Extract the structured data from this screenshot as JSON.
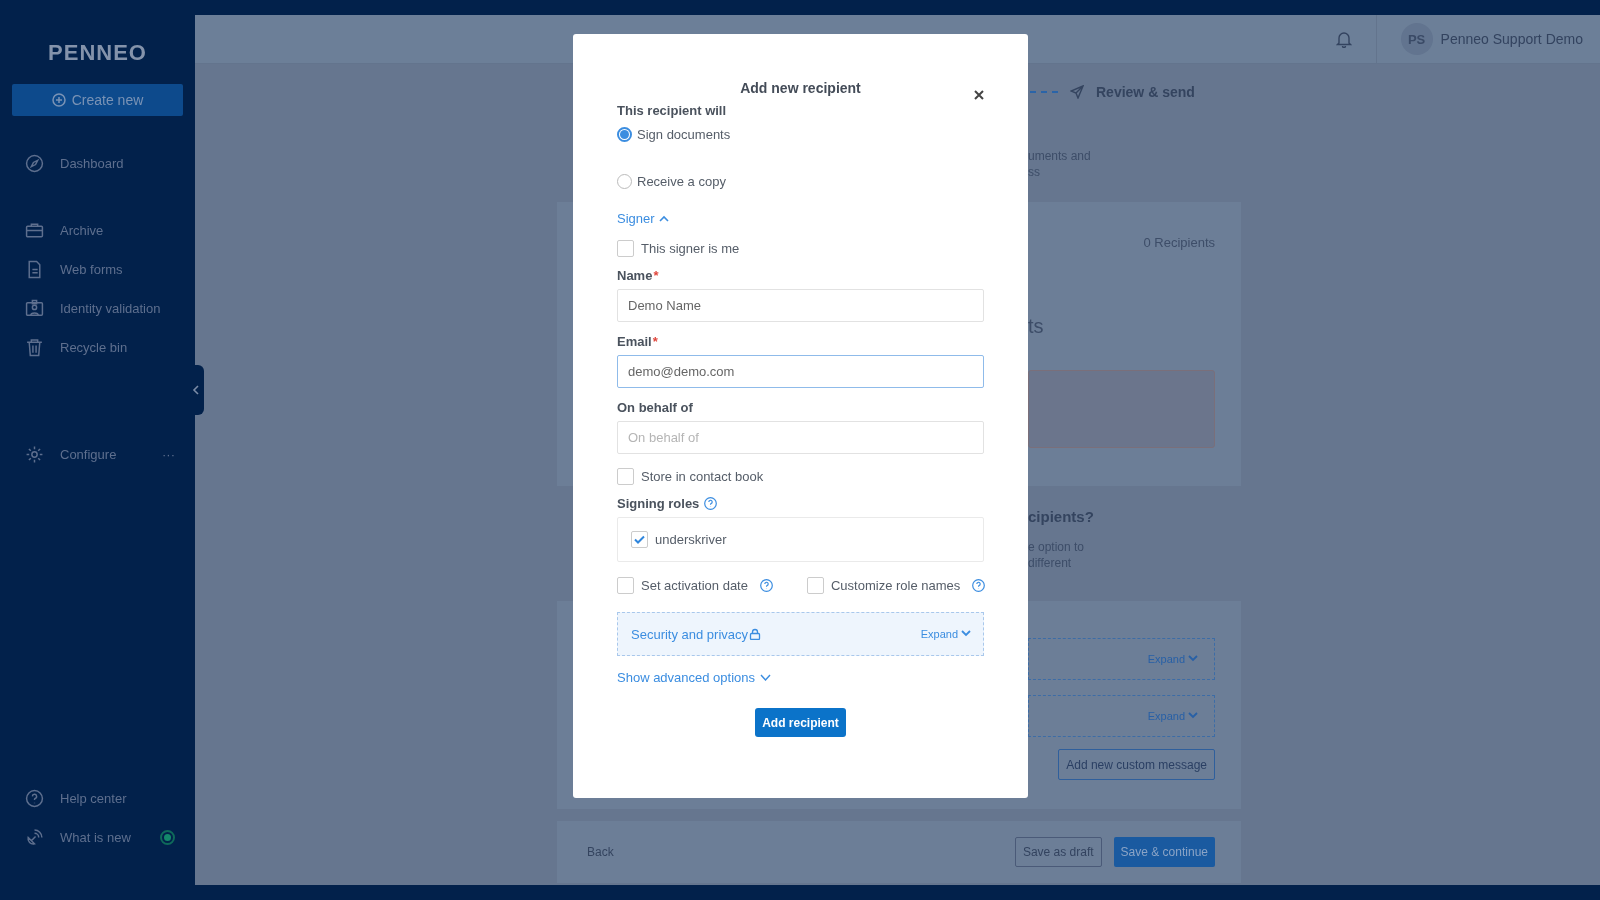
{
  "sidebar": {
    "logo": "PENNEO",
    "create_button": "Create new",
    "nav_groups": [
      [
        {
          "label": "Dashboard"
        }
      ],
      [
        {
          "label": "Archive"
        },
        {
          "label": "Web forms"
        },
        {
          "label": "Identity validation"
        },
        {
          "label": "Recycle bin"
        }
      ],
      [
        {
          "label": "Configure",
          "more": "···"
        }
      ]
    ],
    "bottom_items": [
      {
        "label": "Help center"
      },
      {
        "label": "What is new"
      }
    ]
  },
  "topbar": {
    "user_initials": "PS",
    "user_name": "Penneo Support Demo"
  },
  "page": {
    "step_label": "Review & send",
    "intro_lines": [
      "uments and",
      "ss"
    ],
    "recipients_count": "0 Recipients",
    "card_heading_fragment": "ts",
    "question_fragment": "cipients?",
    "question_lines": [
      "e option to",
      "different"
    ],
    "expand_links": [
      "Expand",
      "Expand"
    ],
    "custom_message_button": "Add new custom message",
    "back_button": "Back",
    "save_draft_button": "Save as draft",
    "save_continue_button": "Save & continue"
  },
  "modal": {
    "title": "Add new recipient",
    "role_label": "This recipient will",
    "role_options": [
      {
        "label": "Sign documents",
        "selected": true
      },
      {
        "label": "Receive a copy",
        "selected": false
      }
    ],
    "section_toggle": {
      "label": "Signer",
      "expanded": true
    },
    "signer_is_me": {
      "label": "This signer is me",
      "checked": false
    },
    "fields": [
      {
        "label": "Name",
        "required_mark": "*",
        "value": "Demo Name",
        "focused": false
      },
      {
        "label": "Email",
        "required_mark": "*",
        "value": "demo@demo.com",
        "focused": true
      },
      {
        "label": "On behalf of",
        "placeholder": "On behalf of",
        "focused": false
      }
    ],
    "store_contact": {
      "label": "Store in contact book",
      "checked": false
    },
    "signing_roles": {
      "label": "Signing roles",
      "roles": [
        {
          "label": "underskriver",
          "checked": true
        }
      ]
    },
    "options": [
      {
        "label": "Set activation date",
        "checked": false
      },
      {
        "label": "Customize role names",
        "checked": false
      }
    ],
    "security": {
      "label": "Security and privacy",
      "expand_label": "Expand",
      "expanded": false
    },
    "advanced": {
      "label": "Show advanced options",
      "expanded": false
    },
    "submit_button": "Add recipient"
  }
}
